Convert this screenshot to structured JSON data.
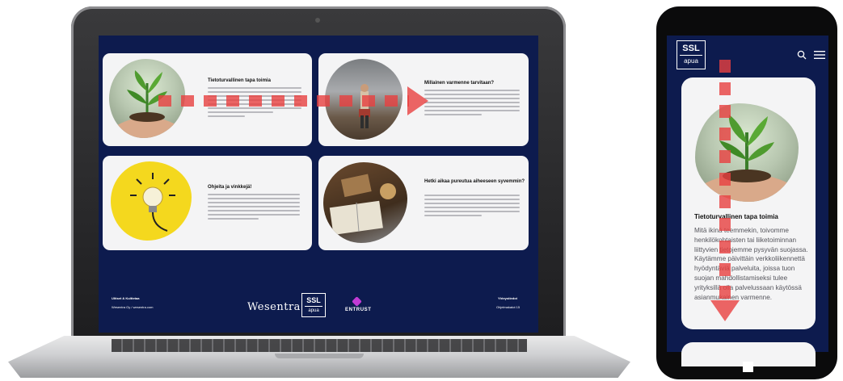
{
  "laptop": {
    "cards": [
      {
        "title": "Tietoturvallinen tapa toimia"
      },
      {
        "title": "Millainen varmenne tarvitaan?"
      },
      {
        "title": "Ohjeita ja vinkkejä!"
      },
      {
        "title": "Hetki aikaa pureutua aiheeseen syvemmin?"
      }
    ],
    "footer": {
      "left_heading": "Ultiset & Kulttetaa",
      "left_line": "Wesentra Oy / wesentra.com",
      "brand": "Wesentra",
      "ssl_top": "SSL",
      "ssl_bottom": "apua",
      "partner": "ENTRUST",
      "right_heading": "Yhteystiedot",
      "right_line": "Ohjelmakatot 15"
    }
  },
  "phone": {
    "logo_top": "SSL",
    "logo_bottom": "apua",
    "search_icon": "search-icon",
    "menu_icon": "menu-icon",
    "card_title": "Tietoturvallinen tapa toimia",
    "card_body": "Mitä ikinä teemmekin, toivomme henkilökohtaisten tai liiketoiminnan liittyvien tietojemme pysyvän suojassa. Käytämme päivittäin verkkoliikennettä hyödyntäviä palveluita, joissa tuon suojan mahdollistamiseksi tulee yrityksillä olla palvelussaan käytössä asianmukainen varmenne."
  },
  "colors": {
    "navy": "#0d1b4e",
    "card": "#f4f4f5",
    "arrow": "#e84040",
    "bulb_yellow": "#f4d81e"
  }
}
